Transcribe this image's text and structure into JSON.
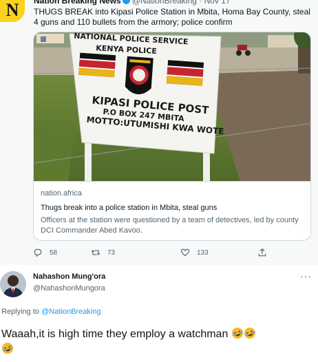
{
  "top_tweet": {
    "author_name": "Nation Breaking News",
    "author_handle": "@NationBreaking",
    "date": "Nov 17",
    "text": "THUGS BREAK into Kipasi Police Station in Mbita, Homa Bay County, steal 4 guns and 110 bullets from the armory; police confirm",
    "sign": {
      "line1": "NATIONAL POLICE SERVICE",
      "line2": "KENYA POLICE",
      "line3": "KIPASI POLICE POST",
      "line4": "P.O BOX 247 MBITA",
      "line5": "MOTTO:UTUMISHI KWA WOTE"
    },
    "card": {
      "domain": "nation.africa",
      "title": "Thugs break into a police station in Mbita, steal guns",
      "description": "Officers at the station were questioned by a team of detectives, led by county DCI Commander Abed Kavoo."
    },
    "actions": {
      "replies": "58",
      "retweets": "73",
      "likes": "133"
    },
    "icons": [
      "reply-icon",
      "retweet-icon",
      "like-icon",
      "share-icon",
      "verified-icon"
    ]
  },
  "reply": {
    "author_name": "Nahashon Mung'ora",
    "author_handle": "@NahashonMungora",
    "more_label": "···",
    "replying_to_prefix": "Replying to",
    "replying_to_mention": "@NationBreaking",
    "text": "Waaah,it is high time they employ a watchman"
  },
  "colors": {
    "accent": "#1d9bf0",
    "secondary_text": "#536471",
    "quoted_bg": "#f7f9f9",
    "border": "#cfd9de"
  }
}
